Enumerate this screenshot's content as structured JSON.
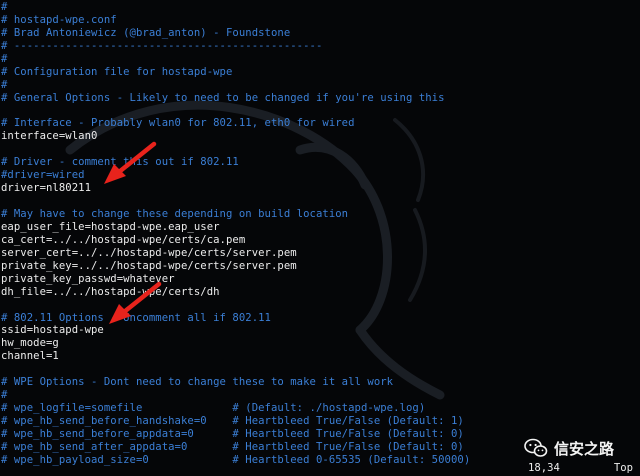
{
  "lines": [
    {
      "text": "#",
      "type": "comment"
    },
    {
      "text": "# hostapd-wpe.conf",
      "type": "comment"
    },
    {
      "text": "# Brad Antoniewicz (@brad_anton) - Foundstone",
      "type": "comment"
    },
    {
      "text": "# ------------------------------------------------",
      "type": "comment"
    },
    {
      "text": "#",
      "type": "comment"
    },
    {
      "text": "# Configuration file for hostapd-wpe",
      "type": "comment"
    },
    {
      "text": "#",
      "type": "comment"
    },
    {
      "text": "# General Options - Likely to need to be changed if you're using this",
      "type": "comment"
    },
    {
      "text": "",
      "type": "blank"
    },
    {
      "text": "# Interface - Probably wlan0 for 802.11, eth0 for wired",
      "type": "comment"
    },
    {
      "text": "interface=wlan0",
      "type": "code"
    },
    {
      "text": "",
      "type": "blank"
    },
    {
      "text": "# Driver - comment this out if 802.11",
      "type": "comment"
    },
    {
      "text": "#driver=wired",
      "type": "comment"
    },
    {
      "text": "driver=nl80211",
      "type": "code"
    },
    {
      "text": "",
      "type": "blank"
    },
    {
      "text": "# May have to change these depending on build location",
      "type": "comment"
    },
    {
      "text": "eap_user_file=hostapd-wpe.eap_user",
      "type": "code"
    },
    {
      "text": "ca_cert=../../hostapd-wpe/certs/ca.pem",
      "type": "code"
    },
    {
      "text": "server_cert=../../hostapd-wpe/certs/server.pem",
      "type": "code"
    },
    {
      "text": "private_key=../../hostapd-wpe/certs/server.pem",
      "type": "code"
    },
    {
      "text": "private_key_passwd=whatever",
      "type": "code"
    },
    {
      "text": "dh_file=../../hostapd-wpe/certs/dh",
      "type": "code"
    },
    {
      "text": "",
      "type": "blank"
    },
    {
      "text": "# 802.11 Options - Uncomment all if 802.11",
      "type": "comment"
    },
    {
      "text": "ssid=hostapd-wpe",
      "type": "code"
    },
    {
      "text": "hw_mode=g",
      "type": "code"
    },
    {
      "text": "channel=1",
      "type": "code"
    },
    {
      "text": "",
      "type": "blank"
    },
    {
      "text": "# WPE Options - Dont need to change these to make it all work",
      "type": "comment"
    },
    {
      "text": "#",
      "type": "comment"
    },
    {
      "text": "# wpe_logfile=somefile              # (Default: ./hostapd-wpe.log)",
      "type": "comment"
    },
    {
      "text": "# wpe_hb_send_before_handshake=0    # Heartbleed True/False (Default: 1)",
      "type": "comment"
    },
    {
      "text": "# wpe_hb_send_before_appdata=0      # Heartbleed True/False (Default: 0)",
      "type": "comment"
    },
    {
      "text": "# wpe_hb_send_after_appdata=0       # Heartbleed True/False (Default: 0)",
      "type": "comment"
    },
    {
      "text": "# wpe_hb_payload_size=0             # Heartbleed 0-65535 (Default: 50000)",
      "type": "comment"
    }
  ],
  "status": {
    "cursor_position": "18,34",
    "scroll_position": "Top"
  },
  "watermark_label": "信安之路",
  "colors": {
    "background": "#050608",
    "comment": "#3b7fd6",
    "code": "#ececec",
    "arrow": "#e8231c"
  },
  "icons": {
    "annotation": "red-arrow-icon",
    "watermark": "wechat-icon",
    "background": "kali-dragon-icon"
  }
}
